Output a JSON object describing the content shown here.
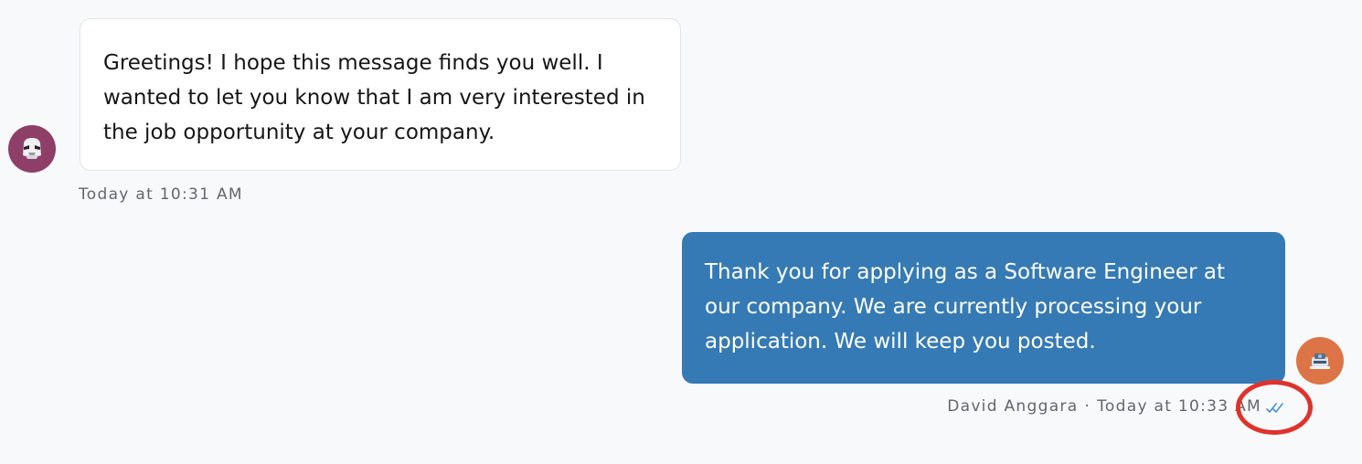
{
  "messages": {
    "incoming": {
      "text": "Greetings! I hope this message finds you well. I wanted to let you know that I am very interested in the job opportunity at your company.",
      "timestamp": "Today at 10:31 AM",
      "avatar_icon": "stormtrooper-avatar-icon",
      "avatar_color": "#8e3f68"
    },
    "outgoing": {
      "text": "Thank you for applying as a Software Engineer at our company. We are currently processing your application. We will keep you posted.",
      "sender": "David Anggara",
      "separator": "·",
      "timestamp": "Today at 10:33 AM",
      "status_icon": "double-check-read-icon",
      "avatar_icon": "robot-avatar-icon",
      "avatar_color": "#dd7445",
      "bubble_color": "#357ab4"
    }
  },
  "annotation": {
    "highlight_color": "#e0322b"
  }
}
